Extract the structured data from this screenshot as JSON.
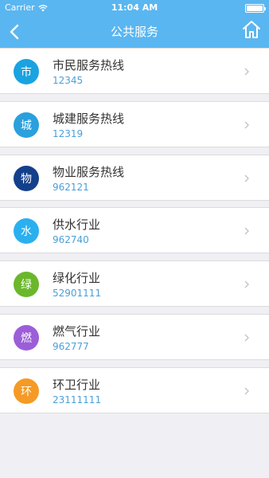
{
  "status_bar": {
    "carrier": "Carrier",
    "time": "11:04 AM",
    "battery_level": 1.0
  },
  "nav": {
    "title": "公共服务",
    "back_icon": "chevron-left-icon",
    "home_icon": "home-icon"
  },
  "services": [
    {
      "badge": "市",
      "name": "市民服务热线",
      "phone": "12345",
      "color": "#1aa3e0"
    },
    {
      "badge": "城",
      "name": "城建服务热线",
      "phone": "12319",
      "color": "#2aa0dc"
    },
    {
      "badge": "物",
      "name": "物业服务热线",
      "phone": "962121",
      "color": "#13408c"
    },
    {
      "badge": "水",
      "name": "供水行业",
      "phone": "962740",
      "color": "#2bb0ef"
    },
    {
      "badge": "绿",
      "name": "绿化行业",
      "phone": "52901111",
      "color": "#6bb72c"
    },
    {
      "badge": "燃",
      "name": "燃气行业",
      "phone": "962777",
      "color": "#9b5ed8"
    },
    {
      "badge": "环",
      "name": "环卫行业",
      "phone": "23111111",
      "color": "#f59a25"
    }
  ]
}
